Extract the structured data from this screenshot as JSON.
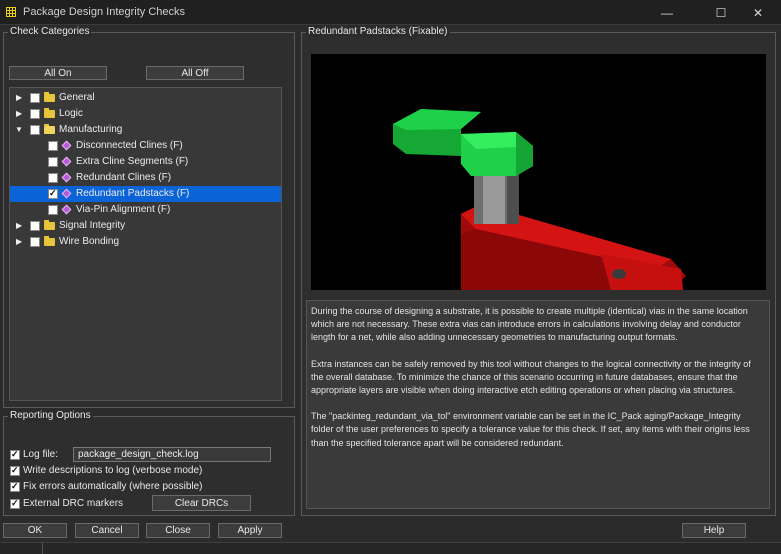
{
  "window": {
    "title": "Package Design Integrity Checks",
    "minimize": "—",
    "maximize": "☐",
    "close": "✕"
  },
  "check_categories": {
    "label": "Check Categories",
    "all_on": "All On",
    "all_off": "All Off",
    "tree": [
      {
        "label": "General"
      },
      {
        "label": "Logic"
      },
      {
        "label": "Manufacturing"
      },
      {
        "label": "Disconnected Clines (F)"
      },
      {
        "label": "Extra Cline Segments (F)"
      },
      {
        "label": "Redundant Clines (F)"
      },
      {
        "label": "Redundant Padstacks (F)"
      },
      {
        "label": "Via-Pin Alignment (F)"
      },
      {
        "label": "Signal Integrity"
      },
      {
        "label": "Wire Bonding"
      }
    ]
  },
  "detail": {
    "label": "Redundant Padstacks (Fixable)",
    "paragraphs": [
      "During the course of designing a substrate, it is possible to create multiple (identical) vias in the same location which are not necessary. These extra vias can introduce errors in calculations involving delay and conductor length for a net, while also adding unnecessary geometries to manufacturing output formats.",
      "Extra instances can be safely removed by this tool without changes to the logical connectivity or the integrity of the overall database. To minimize the chance of this scenario occurring in future databases, ensure that the appropriate layers are visible when doing interactive etch editing operations or when placing via structures.",
      "The \"packinteg_redundant_via_tol\" environment variable can be set in the IC_Pack aging/Package_Integrity folder of the user preferences to specify a tolerance value for this check. If set, any items with their origins less than the specified tolerance apart will be considered redundant."
    ]
  },
  "reporting": {
    "label": "Reporting Options",
    "log_file_label": "Log file:",
    "log_file_value": "package_design_check.log",
    "write_desc": "Write descriptions to log (verbose mode)",
    "fix_errors": "Fix errors automatically (where possible)",
    "external_drc": "External DRC markers",
    "clear_drcs": "Clear DRCs"
  },
  "buttons": {
    "ok": "OK",
    "cancel": "Cancel",
    "close": "Close",
    "apply": "Apply",
    "help": "Help"
  },
  "colors": {
    "selection": "#0a64d8",
    "pad_green": "#1fd14a",
    "trace_red": "#d01010",
    "via_gray": "#8c8c8c"
  }
}
